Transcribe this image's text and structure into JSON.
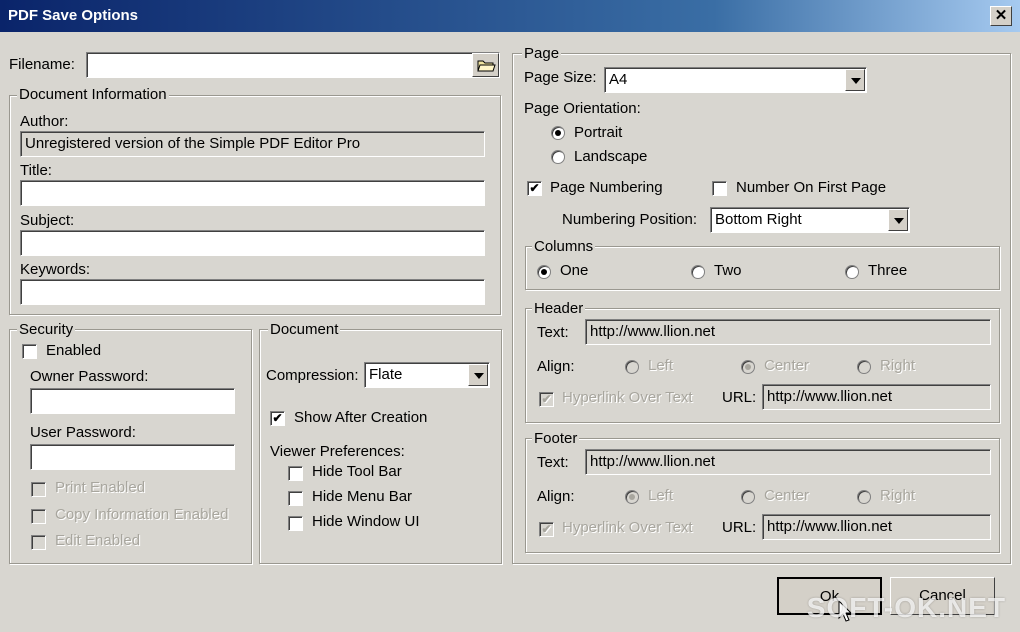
{
  "window": {
    "title": "PDF Save Options",
    "close_glyph": "✕"
  },
  "filename": {
    "label": "Filename:",
    "value": "",
    "browse_icon": "folder-icon"
  },
  "doc_info": {
    "legend": "Document Information",
    "author_label": "Author:",
    "author_value": "Unregistered version of the Simple PDF Editor Pro",
    "title_label": "Title:",
    "title_value": "",
    "subject_label": "Subject:",
    "subject_value": "",
    "keywords_label": "Keywords:",
    "keywords_value": ""
  },
  "security": {
    "legend": "Security",
    "enabled_label": "Enabled",
    "owner_label": "Owner Password:",
    "owner_value": "",
    "user_label": "User Password:",
    "user_value": "",
    "print_label": "Print Enabled",
    "copy_label": "Copy Information Enabled",
    "edit_label": "Edit Enabled",
    "check_glyph": "✔"
  },
  "document": {
    "legend": "Document",
    "compression_label": "Compression:",
    "compression_value": "Flate",
    "show_after_label": "Show After Creation",
    "viewer_prefs_label": "Viewer Preferences:",
    "hide_toolbar_label": "Hide Tool Bar",
    "hide_menubar_label": "Hide Menu Bar",
    "hide_windowui_label": "Hide Window UI"
  },
  "page": {
    "legend": "Page",
    "size_label": "Page Size:",
    "size_value": "A4",
    "orientation_label": "Page Orientation:",
    "portrait_label": "Portrait",
    "landscape_label": "Landscape",
    "numbering_label": "Page Numbering",
    "first_page_label": "Number On First Page",
    "position_label": "Numbering Position:",
    "position_value": "Bottom Right"
  },
  "columns": {
    "legend": "Columns",
    "one": "One",
    "two": "Two",
    "three": "Three"
  },
  "header": {
    "legend": "Header",
    "text_label": "Text:",
    "text_value": "http://www.llion.net",
    "align_label": "Align:",
    "left": "Left",
    "center": "Center",
    "right": "Right",
    "hyperlink_label": "Hyperlink Over Text",
    "url_label": "URL:",
    "url_value": "http://www.llion.net"
  },
  "footer": {
    "legend": "Footer",
    "text_label": "Text:",
    "text_value": "http://www.llion.net",
    "align_label": "Align:",
    "left": "Left",
    "center": "Center",
    "right": "Right",
    "hyperlink_label": "Hyperlink Over Text",
    "url_label": "URL:",
    "url_value": "http://www.llion.net"
  },
  "buttons": {
    "ok": "Ok",
    "cancel": "Cancel"
  },
  "watermark": "SOFT-OK.NET"
}
